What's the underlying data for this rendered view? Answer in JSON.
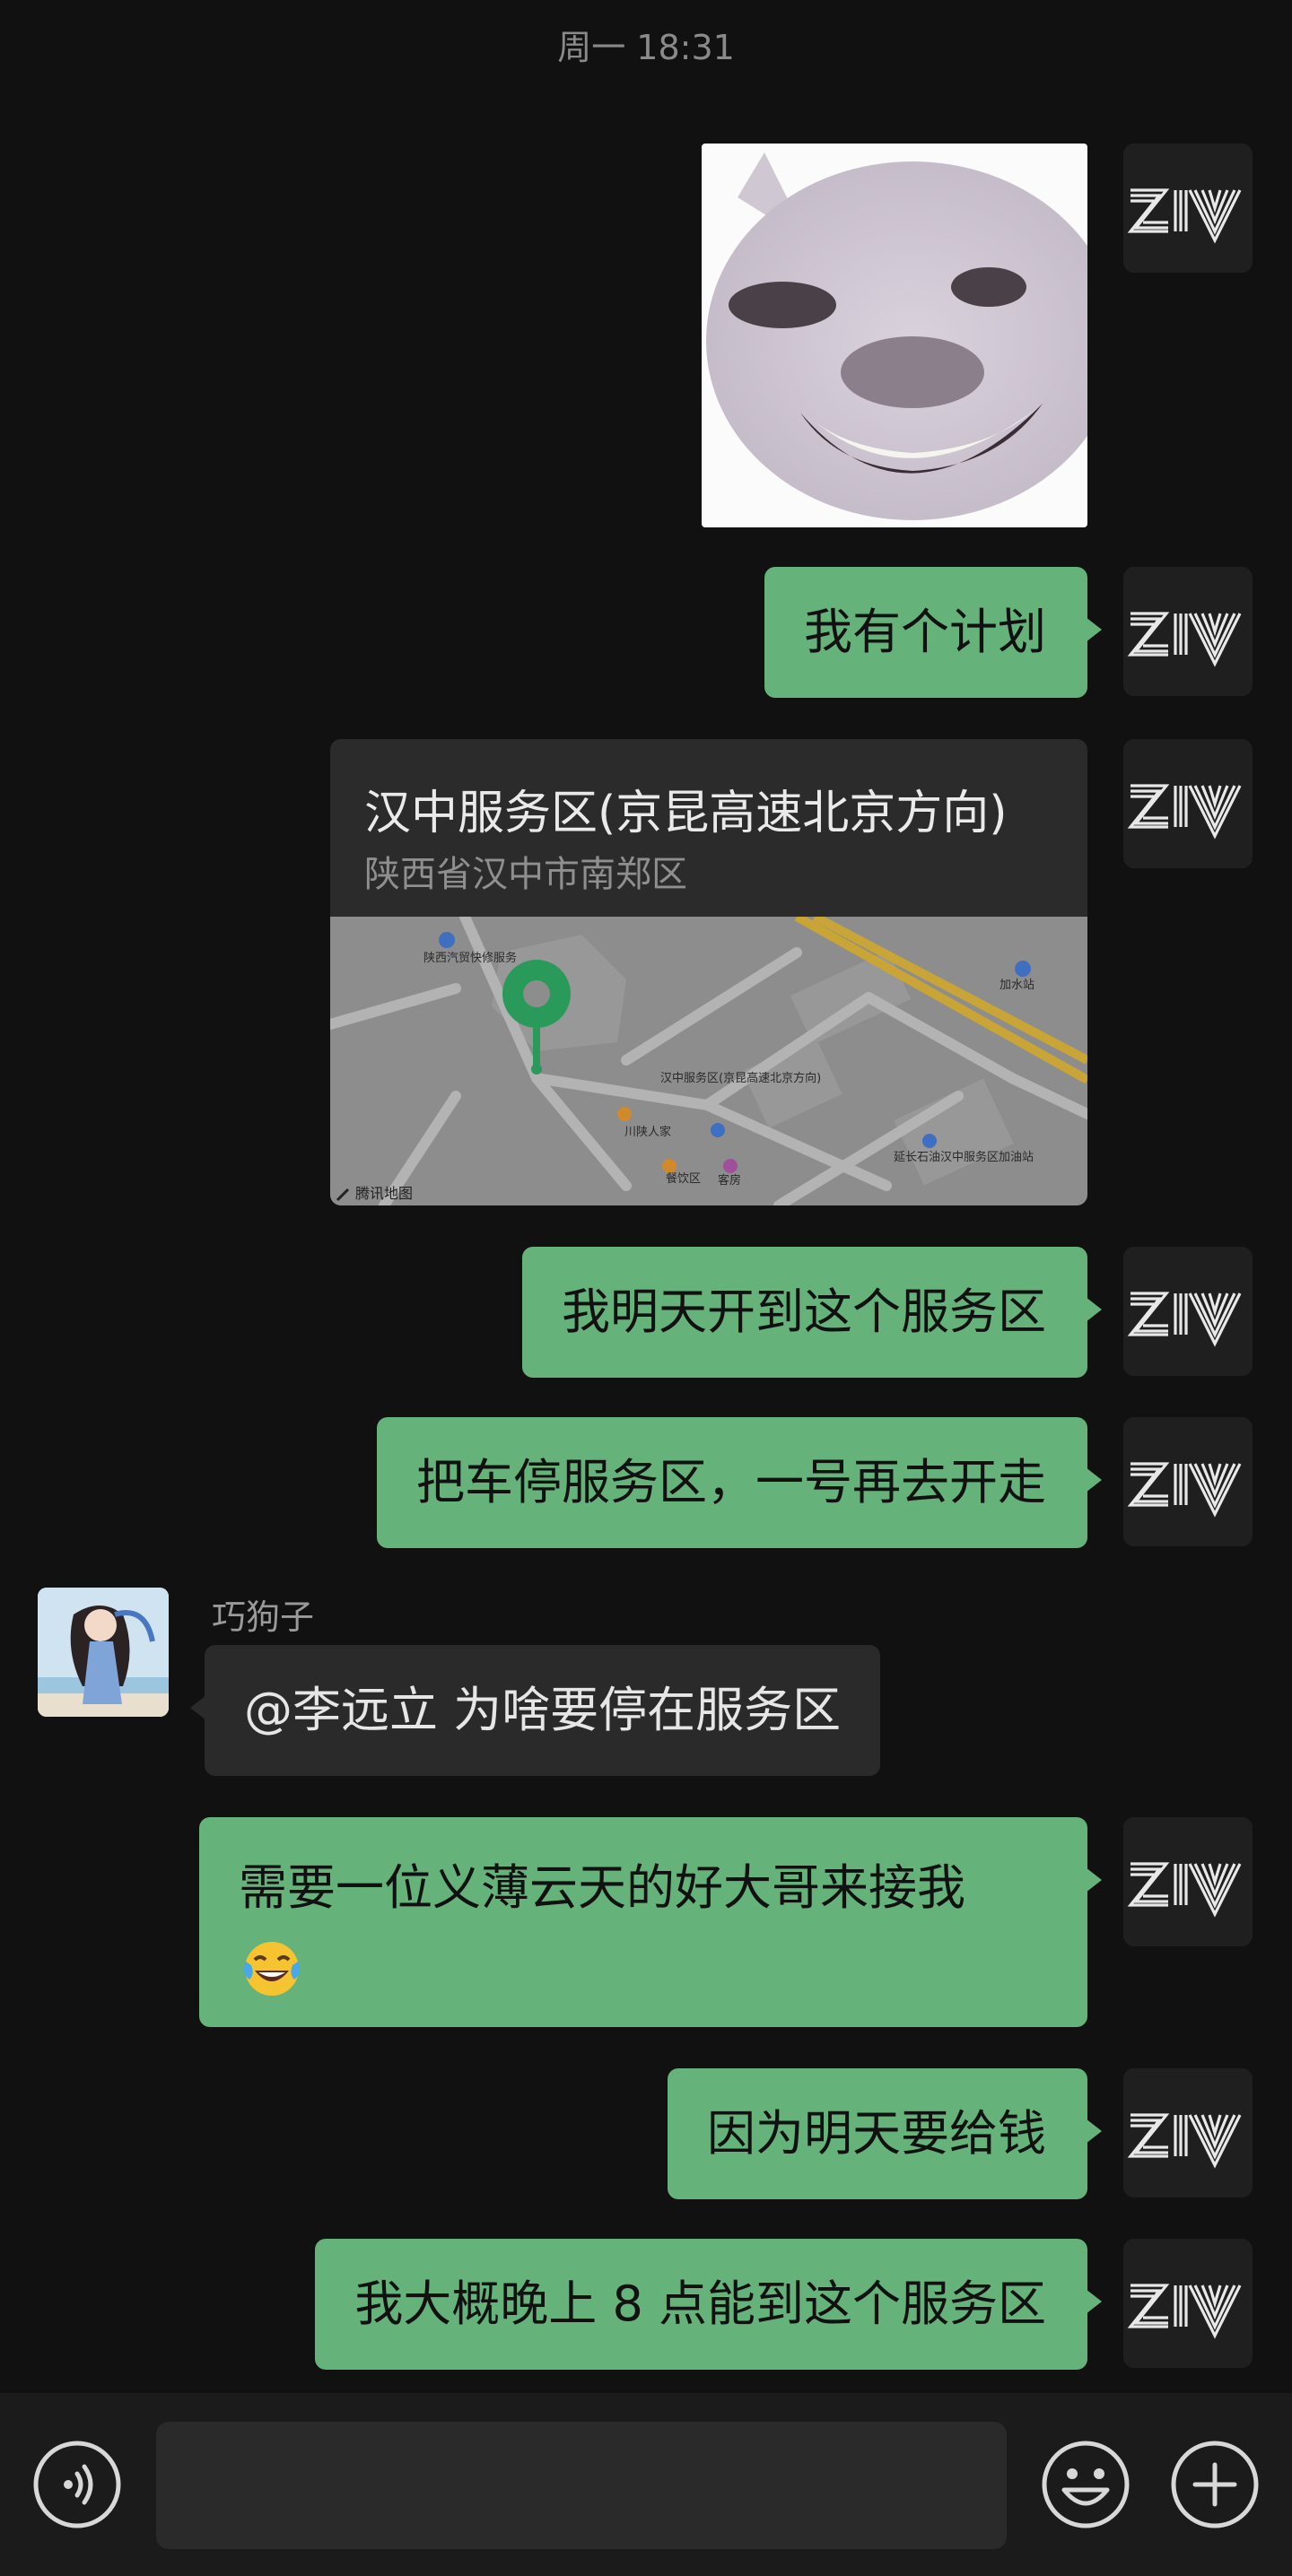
{
  "header": {
    "timestamp": "周一 18:31"
  },
  "me": {
    "avatar_text": "ZIV"
  },
  "messages": [
    {
      "type": "sticker",
      "from": "me",
      "description": "cat meme sticker"
    },
    {
      "type": "text",
      "from": "me",
      "text": "我有个计划"
    },
    {
      "type": "location",
      "from": "me",
      "title": "汉中服务区(京昆高速北京方向)",
      "address": "陕西省汉中市南郑区",
      "map": {
        "labels": [
          "陕西汽贸快修服务",
          "加水站",
          "汉中服务区(京昆高速北京方向)",
          "川陕人家",
          "餐饮区",
          "客房",
          "延长石油汉中服务区加油站"
        ],
        "provider": "腾讯地图"
      }
    },
    {
      "type": "text",
      "from": "me",
      "text": "我明天开到这个服务区"
    },
    {
      "type": "text",
      "from": "me",
      "text": "把车停服务区，一号再去开走"
    },
    {
      "type": "text",
      "from": "other",
      "sender": "巧狗子",
      "text": "@李远立  为啥要停在服务区"
    },
    {
      "type": "text",
      "from": "me",
      "text": "需要一位义薄云天的好大哥来接我",
      "emoji": "face-with-tears-of-joy"
    },
    {
      "type": "text",
      "from": "me",
      "text": "因为明天要给钱"
    },
    {
      "type": "text",
      "from": "me",
      "text": "我大概晚上 8 点能到这个服务区"
    }
  ],
  "input_bar": {
    "voice_icon": "voice-icon",
    "emoji_icon": "emoji-icon",
    "plus_icon": "plus-icon",
    "input_value": ""
  },
  "colors": {
    "background": "#111111",
    "my_bubble": "#65b27b",
    "other_bubble": "#2a2a2a"
  }
}
